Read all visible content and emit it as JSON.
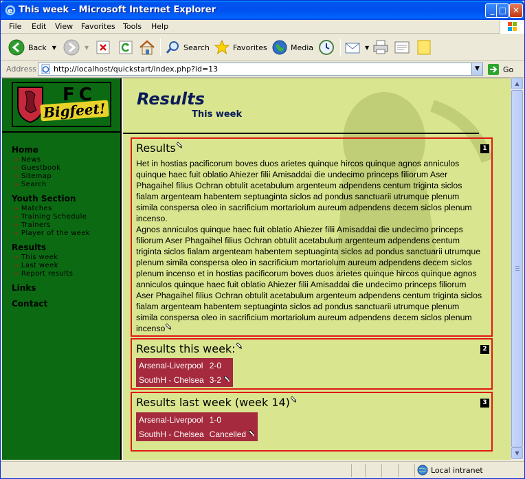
{
  "window": {
    "title": "This week - Microsoft Internet Explorer"
  },
  "menu": [
    "File",
    "Edit",
    "View",
    "Favorites",
    "Tools",
    "Help"
  ],
  "toolbar": {
    "back": "Back",
    "search": "Search",
    "favorites": "Favorites",
    "media": "Media"
  },
  "address": {
    "label": "Address",
    "url": "http://localhost/quickstart/index.php?id=13",
    "go": "Go"
  },
  "status": {
    "zone": "Local intranet"
  },
  "logo": {
    "fc": "FC",
    "name": "Bigfeet!"
  },
  "nav": {
    "home": "Home",
    "home_items": [
      "News",
      "Guestbook",
      "Sitemap",
      "Search"
    ],
    "youth": "Youth Section",
    "youth_items": [
      "Matches",
      "Training Schedule",
      "Trainers",
      "Player of the week"
    ],
    "results": "Results",
    "results_items": [
      "This week",
      "Last week",
      "Report results"
    ],
    "links": "Links",
    "contact": "Contact"
  },
  "page": {
    "title": "Results",
    "subtitle": "This week"
  },
  "boxes": [
    {
      "num": "1",
      "title": "Results",
      "p1": "Het in hostias pacificorum boves duos arietes quinque hircos quinque agnos anniculos quinque haec fuit oblatio Ahiezer filii Amisaddai die undecimo princeps filiorum Aser Phagaihel filius Ochran obtulit acetabulum argenteum adpendens centum triginta siclos fialam argenteam habentem septuaginta siclos ad pondus sanctuarii utrumque plenum simila conspersa oleo in sacrificium mortariolum aureum adpendens decem siclos plenum incenso.",
      "p2": "Agnos anniculos quinque haec fuit oblatio Ahiezer filii Amisaddai die undecimo princeps filiorum Aser Phagaihel filius Ochran obtulit acetabulum argenteum adpendens centum triginta siclos fialam argenteam habentem septuaginta siclos ad pondus sanctuarii utrumque plenum simila conspersa oleo in sacrificium mortariolum aureum adpendens decem siclos plenum incenso et in hostias pacificorum boves duos arietes quinque hircos quinque agnos anniculos quinque haec fuit oblatio Ahiezer filii Amisaddai die undecimo princeps filiorum Aser Phagaihel filius Ochran obtulit acetabulum argenteum adpendens centum triginta siclos fialam argenteam habentem septuaginta siclos ad pondus sanctuarii utrumque plenum simila conspersa oleo in sacrificium mortariolum aureum adpendens decem siclos plenum incenso"
    },
    {
      "num": "2",
      "title": "Results this week:",
      "rows": [
        {
          "match": "Arsenal-Liverpool",
          "score": "2-0"
        },
        {
          "match": "SouthH - Chelsea",
          "score": "3-2"
        }
      ]
    },
    {
      "num": "3",
      "title": "Results last week (week 14)",
      "rows": [
        {
          "match": "Arsenal-Liverpool",
          "score": "1-0"
        },
        {
          "match": "SouthH - Chelsea",
          "score": "Cancelled"
        }
      ]
    }
  ]
}
